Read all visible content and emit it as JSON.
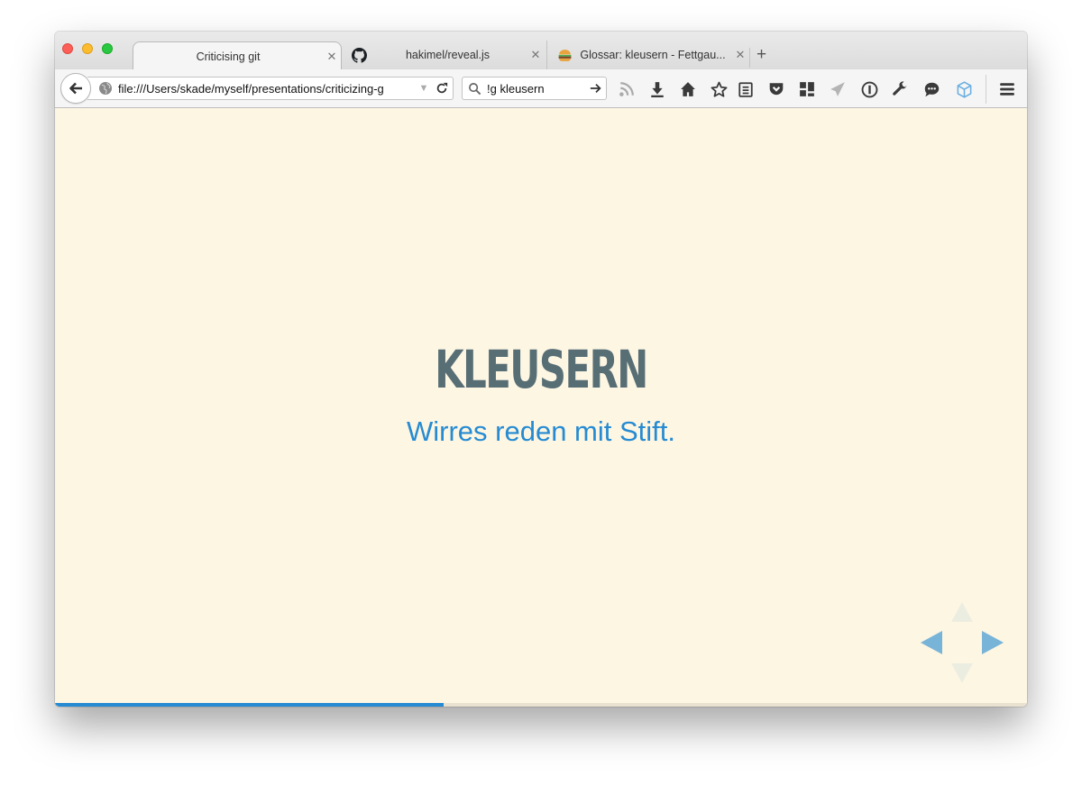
{
  "browser": {
    "tabs": [
      {
        "title": "Criticising git",
        "active": true
      },
      {
        "title": "hakimel/reveal.js",
        "icon": "github-icon"
      },
      {
        "title": "Glossar: kleusern - Fettgau...",
        "icon": "burger-icon"
      }
    ],
    "close_glyph": "✕",
    "newtab_glyph": "+",
    "url": "file:///Users/skade/myself/presentations/criticizing-g",
    "search_value": "!g kleusern",
    "toolbar_icons": [
      "rss-icon",
      "download-icon",
      "home-icon",
      "star-icon",
      "reading-list-icon",
      "pocket-icon",
      "tiles-icon",
      "send-icon",
      "password-icon",
      "wrench-icon",
      "chat-icon",
      "cube-icon",
      "menu-icon"
    ]
  },
  "slide": {
    "title": "KLEUSERN",
    "subtitle": "Wirres reden mit Stift.",
    "progress": 0.4
  },
  "colors": {
    "background": "#fdf6e3",
    "title": "#586e75",
    "accent": "#268bd2"
  }
}
